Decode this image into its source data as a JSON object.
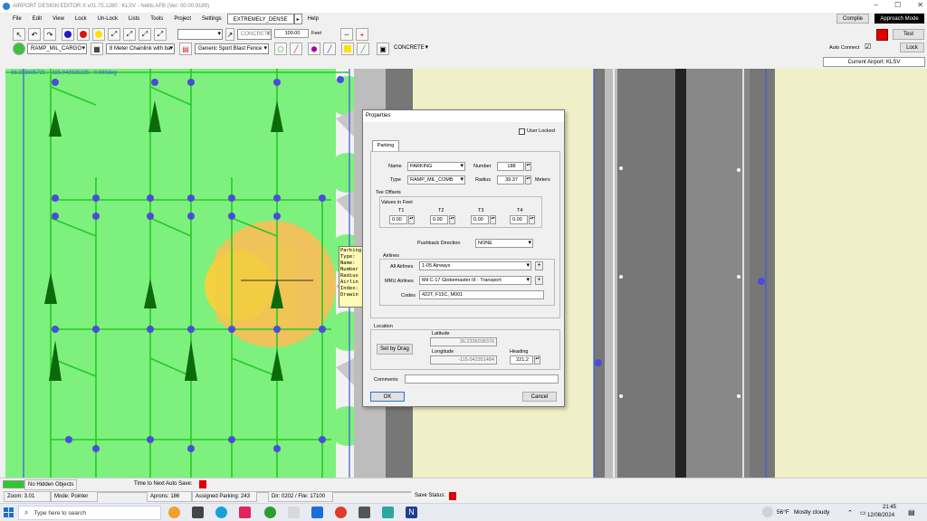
{
  "window": {
    "title": "AIRPORT DESIGN EDITOR X  v01.75.1280 : KLSV - Nellis AFB (Ver: 00.00.9189)",
    "minimize": "–",
    "maximize": "☐",
    "close": "✕"
  },
  "menu": {
    "items": [
      "File",
      "Edit",
      "View",
      "Lock",
      "Un-Lock",
      "Lists",
      "Tools",
      "Project",
      "Settings"
    ],
    "density": "EXTREMELY_DENSE",
    "density_arrow": "▸",
    "help": "Help"
  },
  "topright": {
    "compile": "Compile",
    "approach_mode": "Approach Mode",
    "test": "Test",
    "auto_connect_label": "Auto Connect",
    "auto_connect_checked": "☑",
    "lock": "Lock",
    "current_airport": "Current Airport: KLSV",
    "status_color": "#e00000"
  },
  "toolbar": {
    "surface_select": "CONCRETE",
    "width_value": "100.00",
    "width_unit": "Feet",
    "plus": "+",
    "empty_select": "",
    "parking_type_select": "RAMP_MIL_CARGO",
    "fence_select": "8 Meter Chainlink with ba",
    "blast_fence_select": "Generic Sport Blast Fence",
    "surface_select_2": "CONCRETE"
  },
  "map": {
    "coord_readout": "36.233605721 , -115.042835225 : 0.000deg",
    "grass_color": "#7ef07e",
    "taxi_line_color": "#22cc22",
    "node_color": "#4444dd",
    "highlight_color": "#f2c84b",
    "runway_color": "#707070"
  },
  "parking_popup": {
    "lines": [
      "Parking",
      "Type:",
      "Name:",
      "Number",
      "Radius",
      "Airlin",
      "Index:",
      "Drawin"
    ]
  },
  "dialog": {
    "title": "Properties",
    "user_locked_label": "User Locked",
    "tab": "Parking",
    "name_label": "Name",
    "name_value": "PARKING",
    "number_label": "Number",
    "number_value": "188",
    "type_label": "Type",
    "type_value": "RAMP_MIL_COMB",
    "radius_label": "Radius",
    "radius_value": "39.37",
    "radius_unit": "Meters",
    "tee_offsets_label": "Tee Offsets",
    "values_in_feet_label": "Values in Feet",
    "tee": [
      {
        "label": "T1",
        "value": "0.00"
      },
      {
        "label": "T2",
        "value": "0.00"
      },
      {
        "label": "T3",
        "value": "0.00"
      },
      {
        "label": "T4",
        "value": "0.00"
      }
    ],
    "pushback_label": "Pushback Direction",
    "pushback_value": "NONE",
    "airlines_label": "Airlines",
    "all_airlines_label": "All Airlines",
    "all_airlines_value": "1-05 Airways",
    "mru_airlines_label": "MRU Airlines",
    "mru_airlines_value": "Mil C-17 Globemaster III - Transport",
    "codes_label": "Codes",
    "codes_value": "422T, F15C, M001",
    "location_label": "Location",
    "latitude_label": "Latitude",
    "latitude_value": "36.2336038376",
    "longitude_label": "Longitude",
    "longitude_value": "-115.042351484",
    "set_by_drag": "Set by Drag",
    "heading_label": "Heading",
    "heading_value": "221.2",
    "comments_label": "Comments",
    "comments_value": "",
    "ok": "OK",
    "cancel": "Cancel",
    "plus": "+"
  },
  "statusbar": {
    "no_hidden_objects": "No Hidden Objects",
    "time_to_autosave": "Time to Next Auto Save:",
    "zoom": "Zoom: 3.01",
    "mode": "Mode: Pointer",
    "aprons": "Aprons: 186",
    "assigned_parking": "Assigned Parking: 243",
    "dir_file": "Dir: 0202 / File: 17100",
    "save_status": "Save Status:"
  },
  "taskbar": {
    "search_placeholder": "Type here to search",
    "weather_temp": "56°F",
    "weather_desc": "Mostly cloudy",
    "time": "21:45",
    "date": "12/08/2024"
  }
}
